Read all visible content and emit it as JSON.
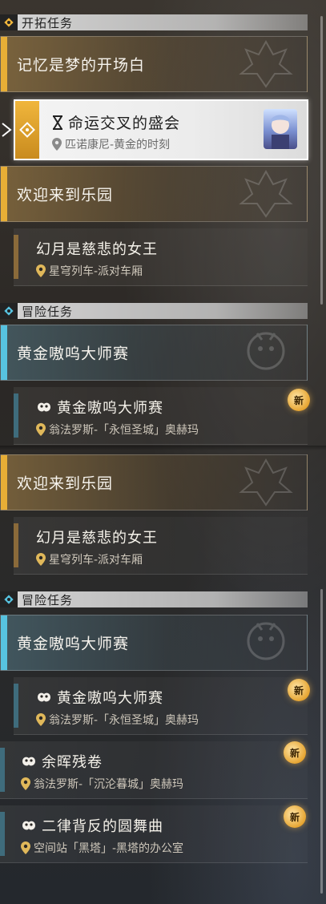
{
  "sections": [
    {
      "id": "trailblaze",
      "title": "开拓任务"
    },
    {
      "id": "adventure1",
      "title": "冒险任务"
    },
    {
      "id": "adventure2",
      "title": "冒险任务"
    }
  ],
  "main_quests": {
    "memory": {
      "title": "记忆是梦的开场白"
    },
    "active": {
      "title": "命运交叉的盛会",
      "location": "匹诺康尼-黄金的时刻"
    },
    "paradise1": {
      "title": "欢迎来到乐园"
    },
    "phantom1": {
      "title": "幻月是慈悲的女王",
      "location": "星穹列车-派对车厢"
    },
    "paradise2": {
      "title": "欢迎来到乐园"
    },
    "phantom2": {
      "title": "幻月是慈悲的女王",
      "location": "星穹列车-派对车厢"
    }
  },
  "adventure": {
    "golden1": {
      "title": "黄金嗷呜大师赛"
    },
    "golden1_sub": {
      "title": "黄金嗷呜大师赛",
      "location": "翁法罗斯-「永恒圣城」奥赫玛",
      "badge": "新"
    },
    "golden2": {
      "title": "黄金嗷呜大师赛"
    },
    "golden2_sub": {
      "title": "黄金嗷呜大师赛",
      "location": "翁法罗斯-「永恒圣城」奥赫玛",
      "badge": "新"
    },
    "ember": {
      "title": "余晖残卷",
      "location": "翁法罗斯-「沉沦暮城」奥赫玛",
      "badge": "新"
    },
    "waltz": {
      "title": "二律背反的圆舞曲",
      "location": "空间站「黑塔」-黑塔的办公室",
      "badge": "新"
    }
  },
  "colors": {
    "trailblaze_accent": "#e7ae36",
    "adventure_accent": "#57c3e0",
    "new_badge": "#e6a532"
  }
}
